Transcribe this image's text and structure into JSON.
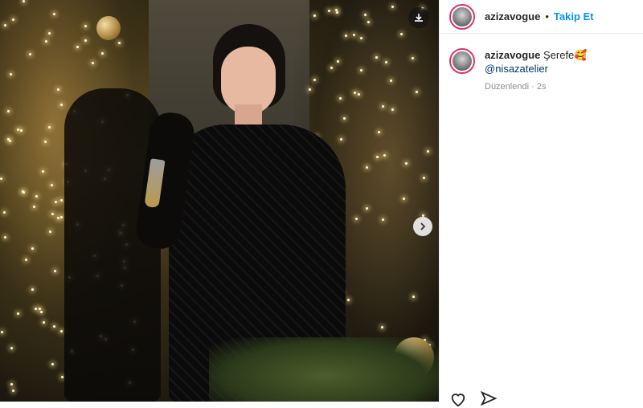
{
  "post": {
    "username": "azizavogue",
    "separator": "•",
    "follow_label": "Takip Et"
  },
  "caption": {
    "username": "azizavogue",
    "text": "Şerefe",
    "emoji": "🥰",
    "mention": "@nisazatelier",
    "edited": "Düzenlendi",
    "time": "2s"
  },
  "icons": {
    "download": "download-icon",
    "next": "chevron-right-icon",
    "like": "heart-icon",
    "share": "send-icon"
  }
}
